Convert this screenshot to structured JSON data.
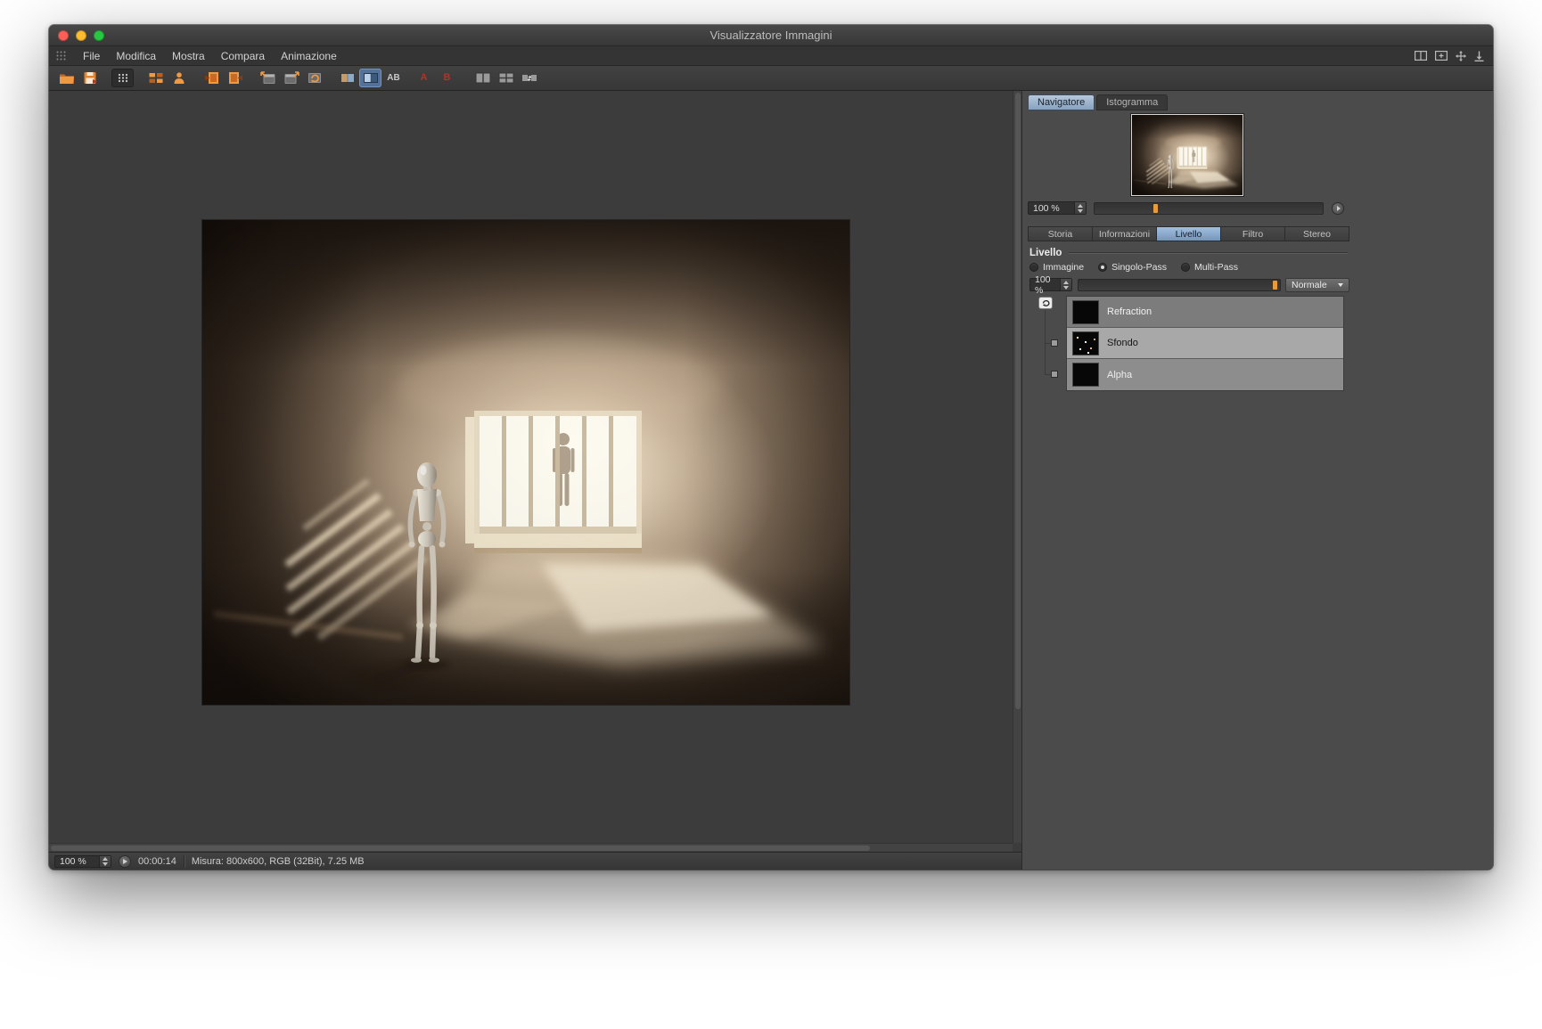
{
  "window": {
    "title": "Visualizzatore Immagini"
  },
  "menubar": {
    "items": [
      "File",
      "Modifica",
      "Mostra",
      "Compara",
      "Animazione"
    ]
  },
  "toolbar": {
    "ab_label": "AB",
    "a_label": "A",
    "b_label": "B",
    "icons": [
      "open-image",
      "save-image",
      "layout-grid",
      "image-tiles",
      "figure-view",
      "previous-image",
      "next-image",
      "expand-window",
      "maximize-window",
      "refresh-view",
      "compare-images",
      "compare-ab-toggle",
      "compare-ab-mode",
      "set-compare-a",
      "set-compare-b",
      "split-horizontal",
      "split-grid",
      "swap-compare"
    ]
  },
  "navigator": {
    "tabs": [
      {
        "label": "Navigatore",
        "active": true
      },
      {
        "label": "Istogramma",
        "active": false
      }
    ],
    "zoom_value": "100 %"
  },
  "panel": {
    "tabs": [
      "Storia",
      "Informazioni",
      "Livello",
      "Filtro",
      "Stereo"
    ],
    "active_tab": "Livello",
    "section_title": "Livello",
    "modes": [
      {
        "label": "Immagine"
      },
      {
        "label": "Singolo-Pass"
      },
      {
        "label": "Multi-Pass"
      }
    ],
    "selected_mode": "Singolo-Pass",
    "opacity_value": "100 %",
    "blend_mode": "Normale",
    "layers": [
      {
        "name": "Refraction"
      },
      {
        "name": "Sfondo"
      },
      {
        "name": "Alpha"
      }
    ],
    "selected_layer": "Sfondo"
  },
  "statusbar": {
    "zoom_value": "100 %",
    "time": "00:00:14",
    "info": "Misura: 800x600, RGB (32Bit), 7.25 MB"
  },
  "colors": {
    "accent_orange": "#e8923f",
    "tab_active_blue": "#8fb2d6",
    "traffic_red": "#ff5f57",
    "traffic_yellow": "#febc2e",
    "traffic_green": "#28c840"
  }
}
